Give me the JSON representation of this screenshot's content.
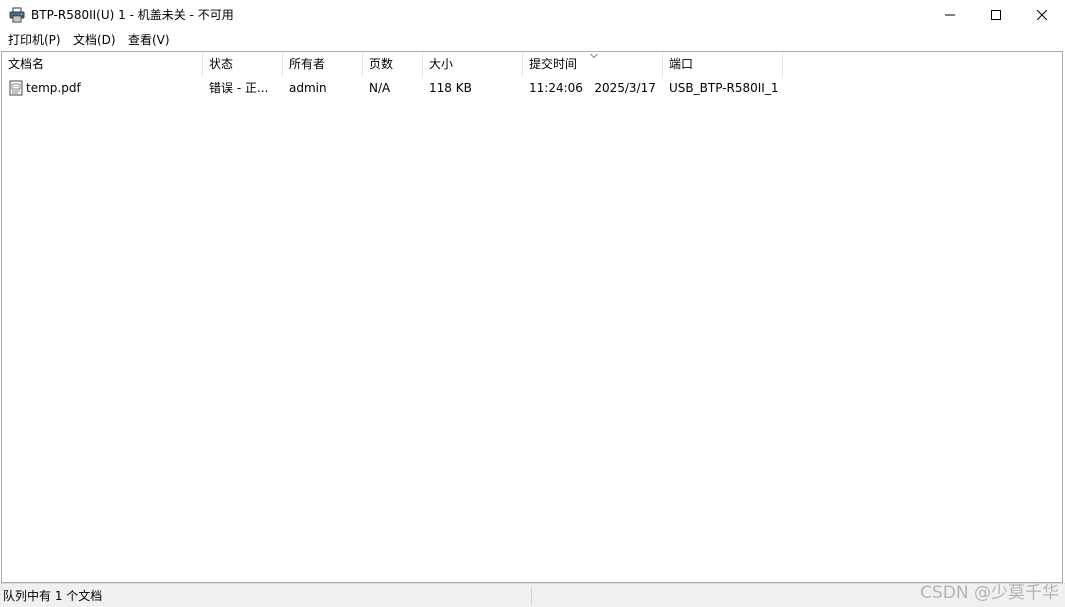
{
  "window": {
    "title": "BTP-R580II(U) 1 - 机盖未关 - 不可用",
    "icon": "printer-icon"
  },
  "menu": {
    "items": [
      {
        "label": "打印机(P)"
      },
      {
        "label": "文档(D)"
      },
      {
        "label": "查看(V)"
      }
    ]
  },
  "columns": [
    {
      "label": "文档名"
    },
    {
      "label": "状态"
    },
    {
      "label": "所有者"
    },
    {
      "label": "页数"
    },
    {
      "label": "大小"
    },
    {
      "label": "提交时间"
    },
    {
      "label": "端口"
    }
  ],
  "rows": [
    {
      "icon": "document-icon",
      "name": "temp.pdf",
      "status": "错误 - 正...",
      "owner": "admin",
      "pages": "N/A",
      "size": "118 KB",
      "submitted": "11:24:06   2025/3/17",
      "port": "USB_BTP-R580II_1"
    }
  ],
  "statusbar": {
    "text": "队列中有 1 个文档"
  },
  "watermark": "CSDN @少莫千华"
}
